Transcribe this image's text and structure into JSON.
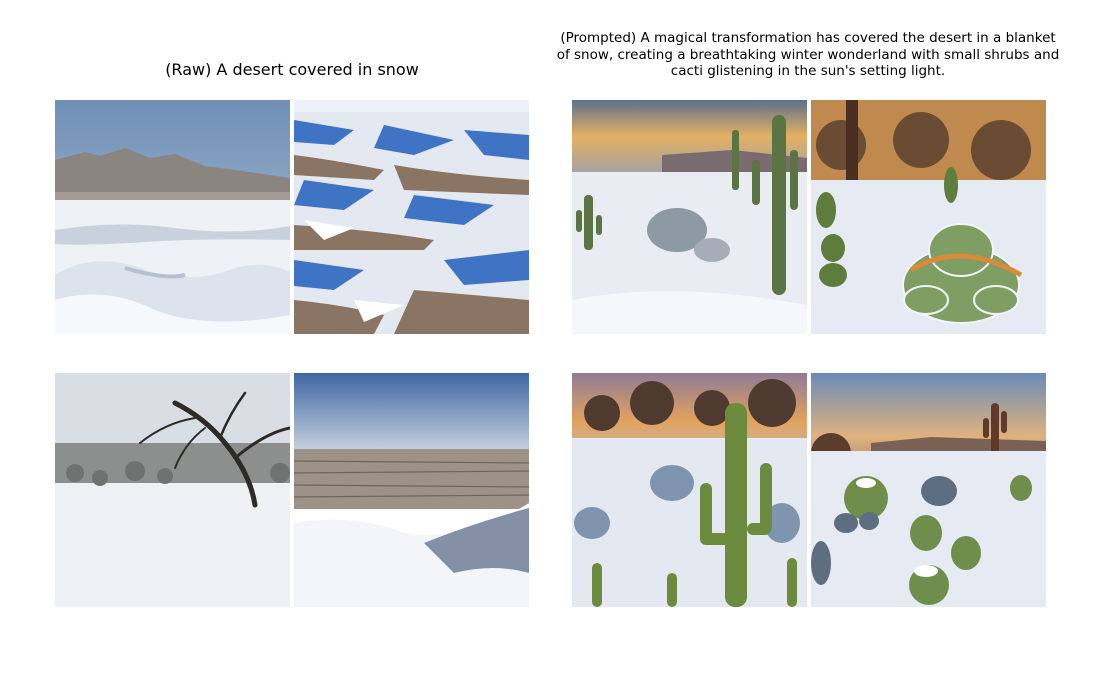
{
  "figure": {
    "left_title": "(Raw) A desert covered in snow",
    "right_title": "(Prompted) A magical transformation has covered the desert in a blanket of snow, creating a breathtaking winter wonderland with small shrubs and cacti glistening in the sun's setting light."
  },
  "colors": {
    "background": "#ffffff",
    "snow": "#e8ecf3",
    "snow_shadow": "#b8c3d6",
    "blue_sky": "#6d8fb8",
    "sunset_orange": "#e6a255",
    "cactus_green": "#5f7a3c",
    "brush_brown": "#6b4a34"
  }
}
